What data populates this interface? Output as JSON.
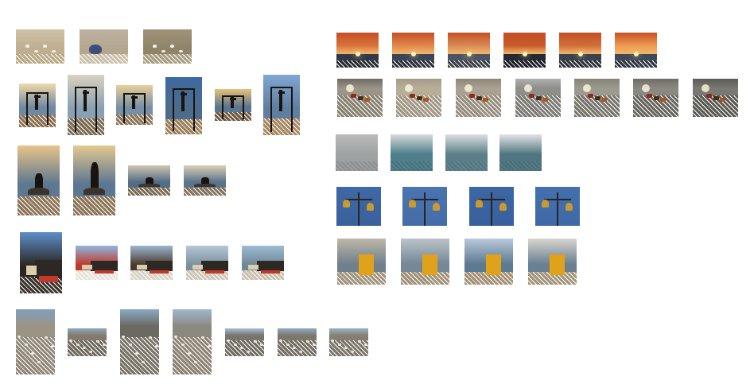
{
  "gallery": {
    "thumbnails": [
      {
        "id": "t1",
        "kind": "sand-birds",
        "sky": "#cfc2a8",
        "sea": "#bfae90",
        "sand": "#b9a784"
      },
      {
        "id": "t2",
        "kind": "pigeon",
        "sky": "#bdb2a0",
        "sea": "#b3a78f",
        "sand": "#c9bfa9"
      },
      {
        "id": "t3",
        "kind": "sand-birds",
        "sky": "#9f9278",
        "sea": "#8f8369",
        "sand": "#a89b80"
      },
      {
        "id": "t4",
        "kind": "sunset",
        "sky": "#d9723a",
        "sea": "#2e3a4a",
        "sand": "#2a2a30"
      },
      {
        "id": "t5",
        "kind": "sunset",
        "sky": "#e0874a",
        "sea": "#3a4658",
        "sand": "#2c3038"
      },
      {
        "id": "t6",
        "kind": "sunset",
        "sky": "#d88a55",
        "sea": "#4a5666",
        "sand": "#3a3e44"
      },
      {
        "id": "t7",
        "kind": "sunset",
        "sky": "#c65a2a",
        "sea": "#222a36",
        "sand": "#1c1e24"
      },
      {
        "id": "t8",
        "kind": "sunset",
        "sky": "#cf6e3a",
        "sea": "#38434f",
        "sand": "#2e3138"
      },
      {
        "id": "t9",
        "kind": "sunset",
        "sky": "#ee9a52",
        "sea": "#3d4a5a",
        "sand": "#2f3540"
      },
      {
        "id": "t10",
        "kind": "bars",
        "sky": "#f0d9a8",
        "sea": "#6f89a3",
        "sand": "#8a6d4e"
      },
      {
        "id": "t11",
        "kind": "bars",
        "sky": "#d9d2c0",
        "sea": "#8aa0b3",
        "sand": "#7a6850"
      },
      {
        "id": "t12",
        "kind": "bars",
        "sky": "#e8cf96",
        "sea": "#7690a8",
        "sand": "#8b7456"
      },
      {
        "id": "t13",
        "kind": "bars",
        "sky": "#3d6aa0",
        "sea": "#4d6c8c",
        "sand": "#9b7f58"
      },
      {
        "id": "t14",
        "kind": "bars",
        "sky": "#e9c07a",
        "sea": "#5c7690",
        "sand": "#6e5a42"
      },
      {
        "id": "t15",
        "kind": "bars",
        "sky": "#7fa6d4",
        "sea": "#5f7f9f",
        "sand": "#a58860"
      },
      {
        "id": "t16",
        "kind": "bottles",
        "sky": "#6e6a62",
        "sea": "#9b9487",
        "sand": "#87806f"
      },
      {
        "id": "t17",
        "kind": "bottles",
        "sky": "#a39a88",
        "sea": "#b8ae98",
        "sand": "#9f9683"
      },
      {
        "id": "t18",
        "kind": "bottles",
        "sky": "#8d8679",
        "sea": "#aaa192",
        "sand": "#958c7c"
      },
      {
        "id": "t19",
        "kind": "bottles",
        "sky": "#aeb0ad",
        "sea": "#8e8f8b",
        "sand": "#7b7a74"
      },
      {
        "id": "t20",
        "kind": "bottles",
        "sky": "#868478",
        "sea": "#9c9a8e",
        "sand": "#75736a"
      },
      {
        "id": "t21",
        "kind": "bottles",
        "sky": "#6f6d66",
        "sea": "#8a8880",
        "sand": "#66645d"
      },
      {
        "id": "t22",
        "kind": "bottles",
        "sky": "#5e5c56",
        "sea": "#7a7872",
        "sand": "#5a5852"
      },
      {
        "id": "t23",
        "kind": "sitter",
        "sky": "#e8c48a",
        "sea": "#5e7890",
        "sand": "#8d7457"
      },
      {
        "id": "t24",
        "kind": "stander",
        "sky": "#e4c98e",
        "sea": "#5c7791",
        "sand": "#8a7356"
      },
      {
        "id": "t25",
        "kind": "sitter",
        "sky": "#cfc6b0",
        "sea": "#546d86",
        "sand": "#7c6a52"
      },
      {
        "id": "t26",
        "kind": "sitter",
        "sky": "#d9cfb6",
        "sea": "#5a738b",
        "sand": "#82705a"
      },
      {
        "id": "t27",
        "kind": "haze",
        "sky": "#b9bbbb",
        "sea": "#9ea1a2",
        "sand": "#8f9293"
      },
      {
        "id": "t28",
        "kind": "haze",
        "sky": "#d7dadb",
        "sea": "#4e7e8a",
        "sand": "#4a7580"
      },
      {
        "id": "t29",
        "kind": "haze",
        "sky": "#dcdfe1",
        "sea": "#5a7f88",
        "sand": "#557883"
      },
      {
        "id": "t30",
        "kind": "haze",
        "sky": "#e3e4e5",
        "sea": "#4f7680",
        "sand": "#4a707a"
      },
      {
        "id": "t31",
        "kind": "lamp",
        "sky": "#3f68a6",
        "sea": "#3a619c",
        "sand": "#365b93"
      },
      {
        "id": "t32",
        "kind": "lamp",
        "sky": "#4a74b2",
        "sea": "#446ca8",
        "sand": "#3f659e"
      },
      {
        "id": "t33",
        "kind": "lamp",
        "sky": "#3c66a5",
        "sea": "#38609c",
        "sand": "#355a93"
      },
      {
        "id": "t34",
        "kind": "lamp",
        "sky": "#4470b0",
        "sea": "#3f69a6",
        "sand": "#3a629c"
      },
      {
        "id": "t35",
        "kind": "tower",
        "sky": "#5d8fc9",
        "sea": "#2b2622",
        "sand": "#3a322c"
      },
      {
        "id": "t36",
        "kind": "tower",
        "sky": "#8fb6df",
        "sea": "#c0392b",
        "sand": "#e7e3dd"
      },
      {
        "id": "t37",
        "kind": "tower",
        "sky": "#9cb6d0",
        "sea": "#4a3a2e",
        "sand": "#d9d2c6"
      },
      {
        "id": "t38",
        "kind": "tower",
        "sky": "#b6c8d8",
        "sea": "#7b8f9c",
        "sand": "#cfc7b6"
      },
      {
        "id": "t39",
        "kind": "tower",
        "sky": "#9fbad3",
        "sea": "#6f8797",
        "sand": "#c9bfac"
      },
      {
        "id": "t40",
        "kind": "chair",
        "sky": "#bfb8a8",
        "sea": "#6f7f8c",
        "sand": "#a0937c"
      },
      {
        "id": "t41",
        "kind": "chair",
        "sky": "#bcc3c8",
        "sea": "#748898",
        "sand": "#9e8f77"
      },
      {
        "id": "t42",
        "kind": "chair",
        "sky": "#b9c9d9",
        "sea": "#5d7a93",
        "sand": "#a18f74"
      },
      {
        "id": "t43",
        "kind": "chair",
        "sky": "#d8d6cf",
        "sea": "#6a8092",
        "sand": "#a3937a"
      },
      {
        "id": "t44",
        "kind": "shells",
        "sky": "#7fa0c0",
        "sea": "#9b9384",
        "sand": "#8f8676"
      },
      {
        "id": "t45",
        "kind": "shells",
        "sky": "#8ea8c2",
        "sea": "#827a6c",
        "sand": "#6d675c"
      },
      {
        "id": "t46",
        "kind": "shells",
        "sky": "#8aa9c6",
        "sea": "#6b6a62",
        "sand": "#777265"
      },
      {
        "id": "t47",
        "kind": "shells",
        "sky": "#9fb7cd",
        "sea": "#8c8a80",
        "sand": "#8a8272"
      },
      {
        "id": "t48",
        "kind": "shells",
        "sky": "#a7c0d6",
        "sea": "#77756c",
        "sand": "#6f6a5f"
      },
      {
        "id": "t49",
        "kind": "shells",
        "sky": "#90abc5",
        "sea": "#7c776b",
        "sand": "#726c60"
      },
      {
        "id": "t50",
        "kind": "shells",
        "sky": "#99b3cb",
        "sea": "#857f72",
        "sand": "#7a7468"
      }
    ]
  }
}
